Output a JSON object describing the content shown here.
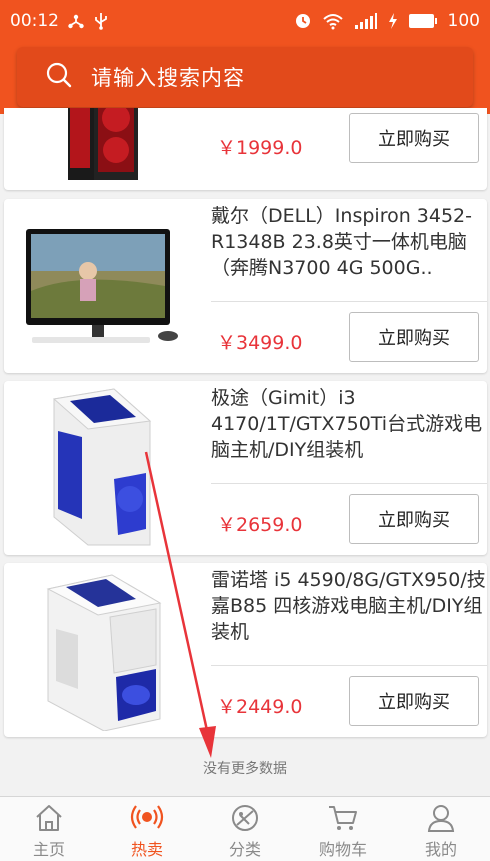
{
  "status_bar": {
    "time": "00:12",
    "battery": "100"
  },
  "search": {
    "placeholder": "请输入搜索内容"
  },
  "products": [
    {
      "title": "",
      "price": "￥1999.0",
      "buy_label": "立即购买"
    },
    {
      "title": "戴尔（DELL）Inspiron 3452-R1348B 23.8英寸一体机电脑 （奔腾N3700 4G 500G..",
      "price": "￥3499.0",
      "buy_label": "立即购买"
    },
    {
      "title": "极途（Gimit）i3 4170/1T/GTX750Ti台式游戏电脑主机/DIY组装机",
      "price": "￥2659.0",
      "buy_label": "立即购买"
    },
    {
      "title": "雷诺塔 i5 4590/8G/GTX950/技嘉B85 四核游戏电脑主机/DIY组装机",
      "price": "￥2449.0",
      "buy_label": "立即购买"
    }
  ],
  "no_more_text": "没有更多数据",
  "tabs": [
    {
      "label": "主页",
      "icon": "home-icon",
      "active": false
    },
    {
      "label": "热卖",
      "icon": "hot-broadcast-icon",
      "active": true
    },
    {
      "label": "分类",
      "icon": "category-icon",
      "active": false
    },
    {
      "label": "购物车",
      "icon": "cart-icon",
      "active": false
    },
    {
      "label": "我的",
      "icon": "user-icon",
      "active": false
    }
  ],
  "colors": {
    "accent": "#f0531f",
    "price": "#e8343a"
  }
}
